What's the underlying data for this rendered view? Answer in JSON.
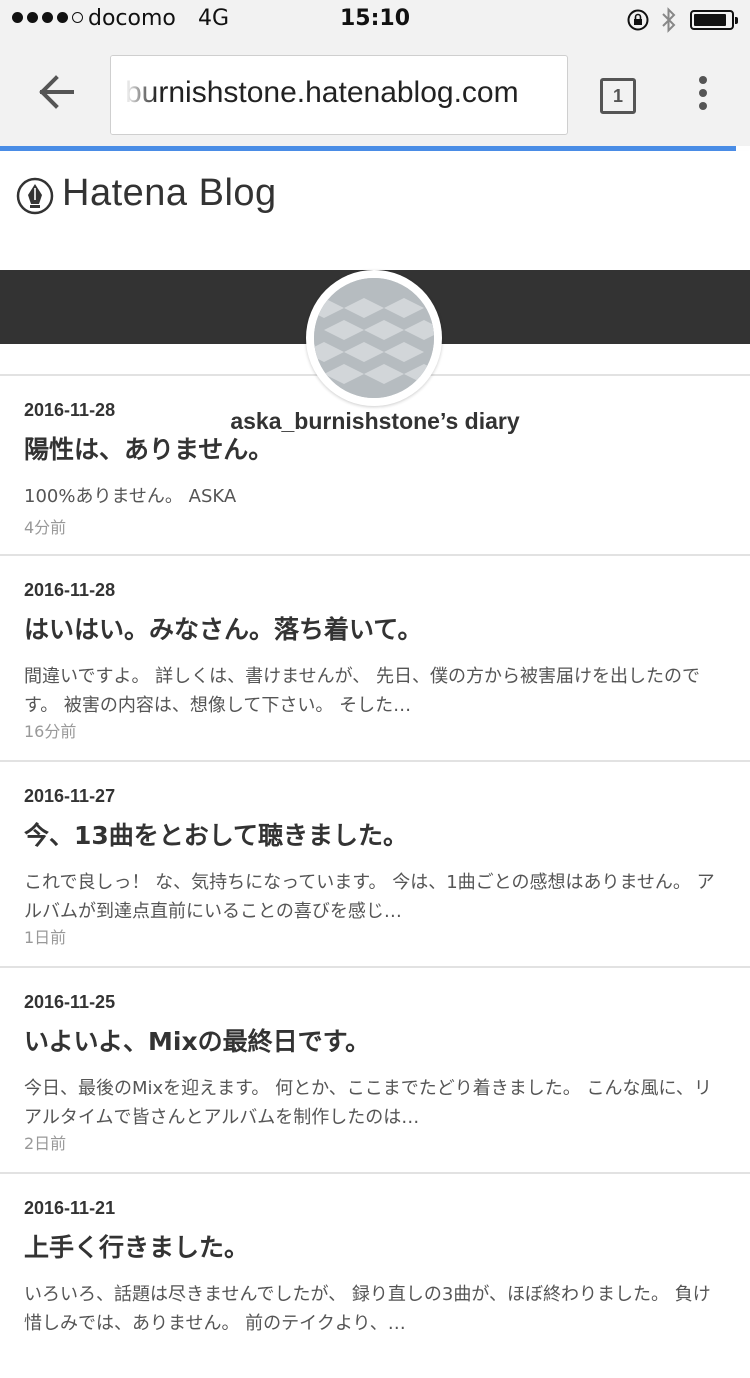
{
  "status_bar": {
    "carrier": "docomo",
    "network": "4G",
    "time": "15:10"
  },
  "browser": {
    "url": "burnishstone.hatenablog.com",
    "tab_count": "1",
    "progress_color": "#4a8de6"
  },
  "site": {
    "logo_text": "Hatena Blog"
  },
  "blog": {
    "title": "aska_burnishstone’s diary",
    "banner_color": "#333333"
  },
  "entries": [
    {
      "date": "2016-11-28",
      "title": "陽性は、ありません。",
      "summary": "100%ありません。 ASKA",
      "time_ago": "4分前"
    },
    {
      "date": "2016-11-28",
      "title": "はいはい。みなさん。落ち着いて。",
      "summary": "間違いですよ。 詳しくは、書けませんが、 先日、僕の方から被害届けを出したのです。 被害の内容は、想像して下さい。 そした…",
      "time_ago": "16分前"
    },
    {
      "date": "2016-11-27",
      "title": "今、13曲をとおして聴きました。",
      "summary": "これで良しっ！ な、気持ちになっています。 今は、1曲ごとの感想はありません。 アルバムが到達点直前にいることの喜びを感じ…",
      "time_ago": "1日前"
    },
    {
      "date": "2016-11-25",
      "title": "いよいよ、Mixの最終日です。",
      "summary": "今日、最後のMixを迎えます。 何とか、ここまでたどり着きました。 こんな風に、リアルタイムで皆さんとアルバムを制作したのは…",
      "time_ago": "2日前"
    },
    {
      "date": "2016-11-21",
      "title": "上手く行きました。",
      "summary": "いろいろ、話題は尽きませんでしたが、 録り直しの3曲が、ほぼ終わりました。 負け惜しみでは、ありません。 前のテイクより、…",
      "time_ago": ""
    }
  ]
}
